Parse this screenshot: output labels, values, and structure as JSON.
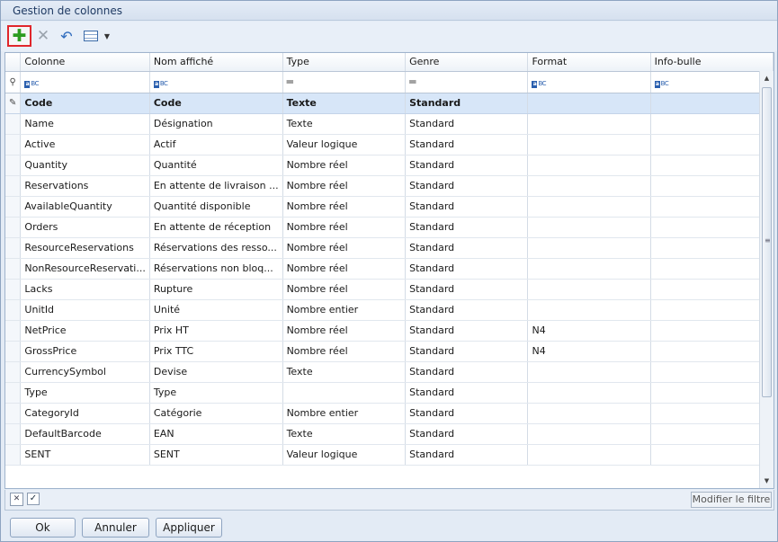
{
  "window": {
    "title": "Gestion de colonnes"
  },
  "toolbar": {
    "add_icon": "plus-icon",
    "delete_icon": "close-icon",
    "undo_icon": "undo-icon",
    "grid_icon": "grid-layout-icon",
    "dropdown_icon": "chevron-down-icon",
    "highlight_color": "#e0262b"
  },
  "grid": {
    "columns": [
      "Colonne",
      "Nom affiché",
      "Type",
      "Genre",
      "Format",
      "Info-bulle"
    ],
    "filter_icons": [
      "text-filter-icon",
      "text-filter-icon",
      "equals-filter-icon",
      "equals-filter-icon",
      "text-filter-icon",
      "text-filter-icon"
    ],
    "rows": [
      [
        "Code",
        "Code",
        "Texte",
        "Standard",
        "",
        ""
      ],
      [
        "Name",
        "Désignation",
        "Texte",
        "Standard",
        "",
        ""
      ],
      [
        "Active",
        "Actif",
        "Valeur logique",
        "Standard",
        "",
        ""
      ],
      [
        "Quantity",
        "Quantité",
        "Nombre réel",
        "Standard",
        "",
        ""
      ],
      [
        "Reservations",
        "En attente de livraison ...",
        "Nombre réel",
        "Standard",
        "",
        ""
      ],
      [
        "AvailableQuantity",
        "Quantité disponible",
        "Nombre réel",
        "Standard",
        "",
        ""
      ],
      [
        "Orders",
        "En attente de réception",
        "Nombre réel",
        "Standard",
        "",
        ""
      ],
      [
        "ResourceReservations",
        "Réservations des resso...",
        "Nombre réel",
        "Standard",
        "",
        ""
      ],
      [
        "NonResourceReservati...",
        "Réservations non bloq...",
        "Nombre réel",
        "Standard",
        "",
        ""
      ],
      [
        "Lacks",
        "Rupture",
        "Nombre réel",
        "Standard",
        "",
        ""
      ],
      [
        "UnitId",
        "Unité",
        "Nombre entier",
        "Standard",
        "",
        ""
      ],
      [
        "NetPrice",
        "Prix HT",
        "Nombre réel",
        "Standard",
        "N4",
        ""
      ],
      [
        "GrossPrice",
        "Prix TTC",
        "Nombre réel",
        "Standard",
        "N4",
        ""
      ],
      [
        "CurrencySymbol",
        "Devise",
        "Texte",
        "Standard",
        "",
        ""
      ],
      [
        "Type",
        "Type",
        "",
        "Standard",
        "",
        ""
      ],
      [
        "CategoryId",
        "Catégorie",
        "Nombre entier",
        "Standard",
        "",
        ""
      ],
      [
        "DefaultBarcode",
        "EAN",
        "Texte",
        "Standard",
        "",
        ""
      ],
      [
        "SENT",
        "SENT",
        "Valeur logique",
        "Standard",
        "",
        ""
      ]
    ],
    "selected_row": 0,
    "selection_color": "#d7e6f8"
  },
  "footer": {
    "clear_filter_icon": "close-icon",
    "filter_enabled": true,
    "modify_filter_label": "Modifier le filtre"
  },
  "buttons": {
    "ok": "Ok",
    "cancel": "Annuler",
    "apply": "Appliquer"
  }
}
